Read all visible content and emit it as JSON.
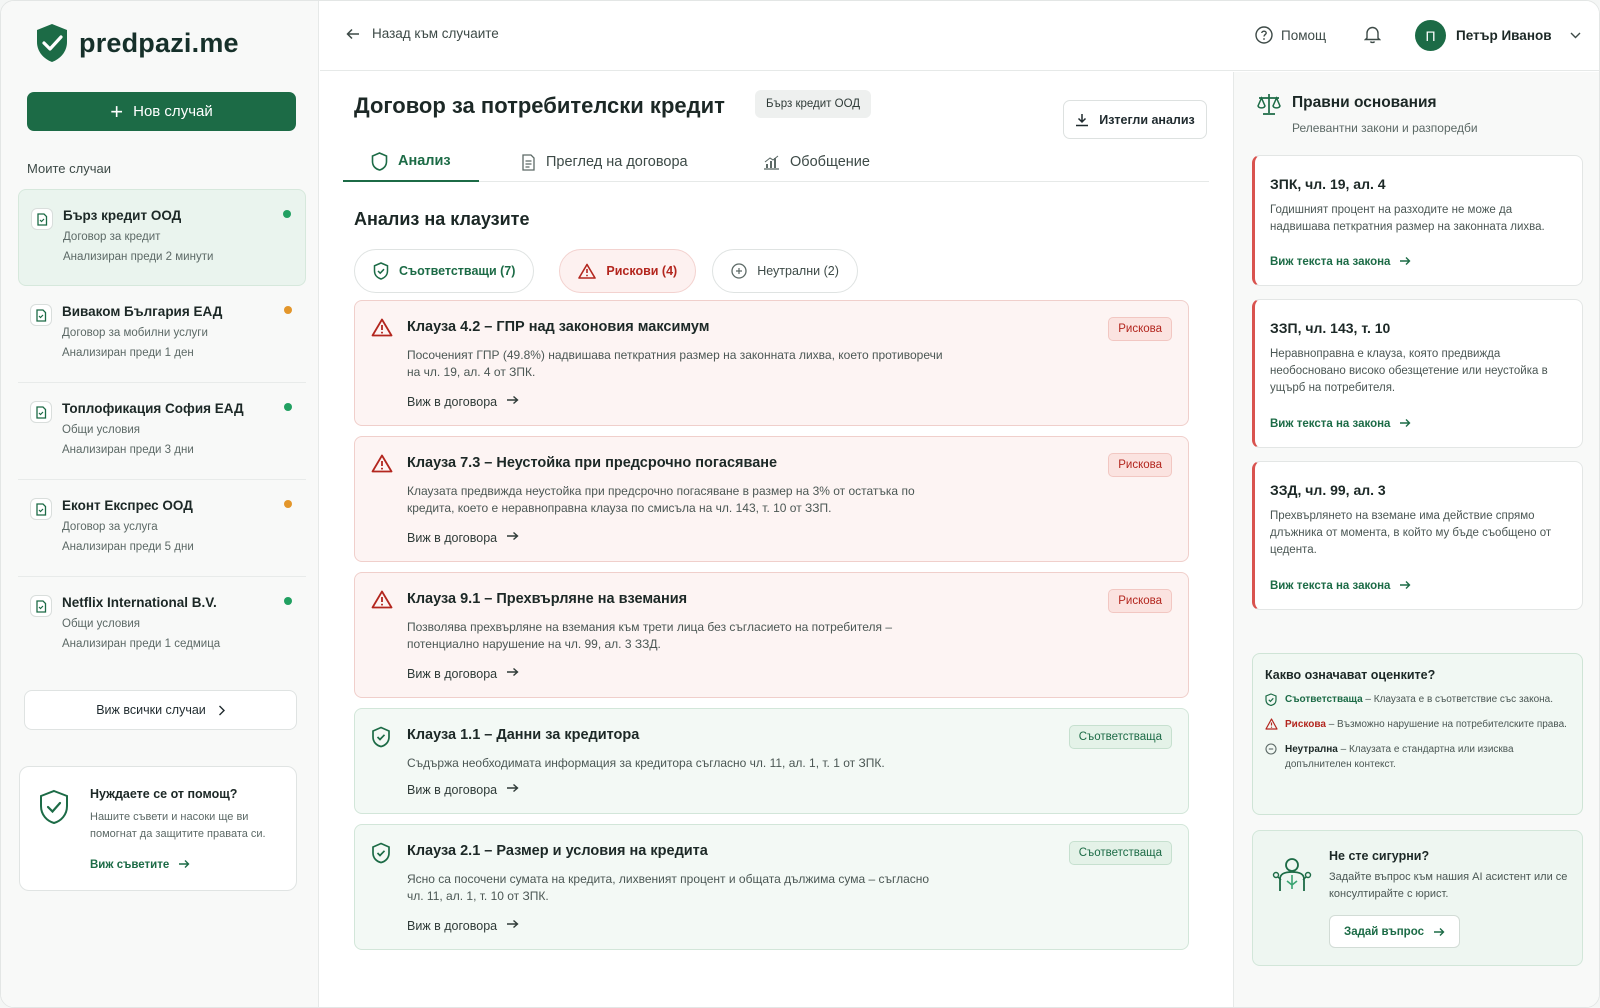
{
  "app": {
    "logo_text": "predpazi.me",
    "brand_color": "#1c6b46"
  },
  "sidebar": {
    "new_case_label": "Нов случай",
    "section_label": "Моите случаи",
    "cases": [
      {
        "title": "Бърз кредит ООД",
        "subtitle": "Договор за кредит",
        "time": "Анализиран преди 2 минути",
        "status": "green"
      },
      {
        "title": "Виваком България ЕАД",
        "subtitle": "Договор за мобилни услуги",
        "time": "Анализиран преди 1 ден",
        "status": "orange"
      },
      {
        "title": "Топлофикация София ЕАД",
        "subtitle": "Общи условия",
        "time": "Анализиран преди 3 дни",
        "status": "green"
      },
      {
        "title": "Еконт Експрес ООД",
        "subtitle": "Договор за услуга",
        "time": "Анализиран преди 5 дни",
        "status": "orange"
      },
      {
        "title": "Netflix International B.V.",
        "subtitle": "Общи условия",
        "time": "Анализиран преди 1 седмица",
        "status": "green"
      }
    ],
    "all_cases_label": "Виж всички случаи",
    "help": {
      "title": "Нуждаете се от помощ?",
      "text": "Нашите съвети и насоки ще ви помогнат да защитите правата си.",
      "link": "Виж съветите"
    }
  },
  "topbar": {
    "back_label": "Назад към случаите",
    "help_label": "Помощ",
    "user_initial": "П",
    "user_name": "Петър Иванов"
  },
  "main": {
    "title": "Договор за потребителски кредит",
    "company_chip": "Бърз кредит ООД",
    "download_label": "Изтегли анализ",
    "tabs": [
      {
        "label": "Анализ"
      },
      {
        "label": "Преглед на договора"
      },
      {
        "label": "Обобщение"
      }
    ],
    "section_title": "Анализ на клаузите",
    "filters": {
      "compliant": "Съответстващи (7)",
      "risky": "Рискови (4)",
      "neutral": "Неутрални (2)"
    },
    "clauses": [
      {
        "kind": "risky",
        "title": "Клауза 4.2 – ГПР над законовия максимум",
        "desc": "Посоченият ГПР (49.8%) надвишава петкратния размер на законната лихва, което противоречи на чл. 19, ал. 4 от ЗПК.",
        "badge": "Рискова",
        "link": "Виж в договора"
      },
      {
        "kind": "risky",
        "title": "Клауза 7.3 – Неустойка при предсрочно погасяване",
        "desc": "Клаузата предвижда неустойка при предсрочно погасяване в размер на 3% от остатъка по кредита, което е неравноправна клауза по смисъла на чл. 143, т. 10 от ЗЗП.",
        "badge": "Рискова",
        "link": "Виж в договора"
      },
      {
        "kind": "risky",
        "title": "Клауза 9.1 – Прехвърляне на вземания",
        "desc": "Позволява прехвърляне на вземания към трети лица без съгласието на потребителя – потенциално нарушение на чл. 99, ал. 3 ЗЗД.",
        "badge": "Рискова",
        "link": "Виж в договора"
      },
      {
        "kind": "ok",
        "title": "Клауза 1.1 – Данни за кредитора",
        "desc": "Съдържа необходимата информация за кредитора съгласно чл. 11, ал. 1, т. 1 от ЗПК.",
        "badge": "Съответстваща",
        "link": "Виж в договора"
      },
      {
        "kind": "ok",
        "title": "Клауза 2.1 – Размер и условия на кредита",
        "desc": "Ясно са посочени сумата на кредита, лихвеният процент и общата дължима сума – съгласно чл. 11, ал. 1, т. 10 от ЗПК.",
        "badge": "Съответстваща",
        "link": "Виж в договора"
      }
    ]
  },
  "right": {
    "title": "Правни основания",
    "subtitle": "Релевантни закони и разпоредби",
    "laws": [
      {
        "title": "ЗПК, чл. 19, ал. 4",
        "text": "Годишният процент на разходите не може да надвишава петкратния размер на законната лихва.",
        "link": "Виж текста на закона"
      },
      {
        "title": "ЗЗП, чл. 143, т. 10",
        "text": "Неравноправна е клауза, която предвижда необосновано високо обезщетение или неустойка в ущърб на потребителя.",
        "link": "Виж текста на закона"
      },
      {
        "title": "ЗЗД, чл. 99, ал. 3",
        "text": "Прехвърлянето на вземане има действие спрямо длъжника от момента, в който му бъде съобщено от цедента.",
        "link": "Виж текста на закона"
      }
    ],
    "legend": {
      "title": "Какво означават оценките?",
      "compliant_term": "Съответстваща",
      "compliant_text": " – Клаузата е в съответствие със закона.",
      "risky_term": "Рискова",
      "risky_text": " – Възможно нарушение на потребителските права.",
      "neutral_term": "Неутрална",
      "neutral_text": " – Клаузата е стандартна или изисква допълнителен контекст."
    },
    "ask": {
      "title": "Не сте сигурни?",
      "text": "Задайте въпрос към нашия AI асистент или се консултирайте с юрист.",
      "button": "Задай въпрос"
    }
  }
}
